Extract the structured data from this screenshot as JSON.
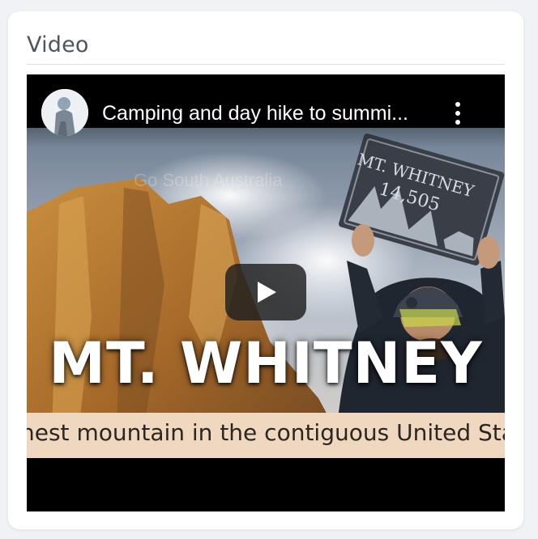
{
  "card": {
    "title": "Video"
  },
  "video": {
    "title": "Camping and day hike to summi...",
    "thumbnail_headline": "MT. WHITNEY",
    "thumbnail_subtitle": "hest mountain in the contiguous United Sta",
    "sign_line1": "MT. WHITNEY",
    "sign_line2": "14,505",
    "ghost_text": "Go South Australia"
  },
  "icons": {
    "avatar": "channel-avatar-icon",
    "menu": "more-vert-icon",
    "play": "play-icon"
  },
  "colors": {
    "play_button_bg": "#1e1e1e",
    "subtitle_strip": "#efd8bf"
  }
}
